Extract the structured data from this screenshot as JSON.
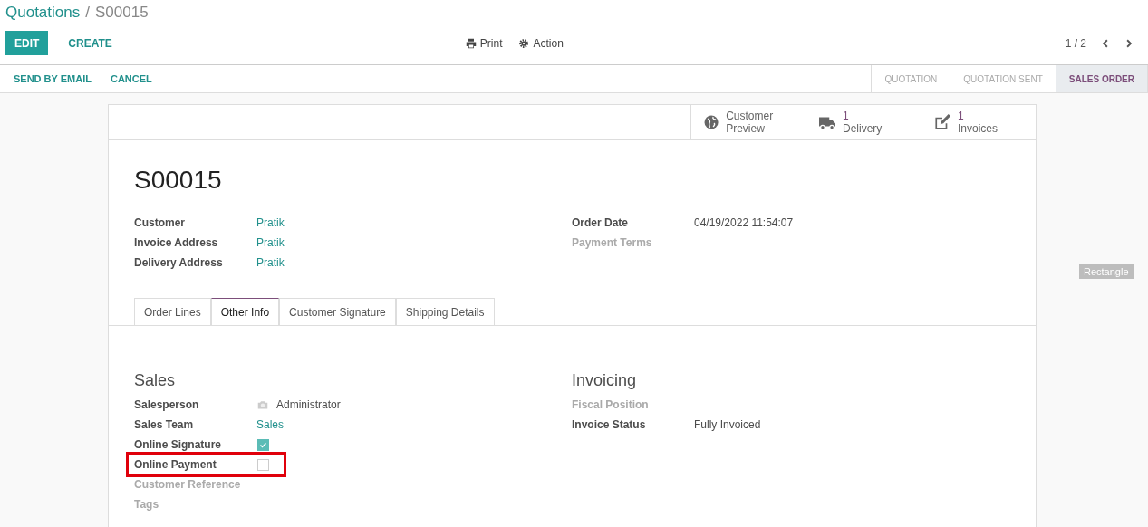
{
  "breadcrumb": {
    "parent": "Quotations",
    "separator": "/",
    "current": "S00015"
  },
  "buttons": [
    {
      "label": "EDIT",
      "primary": true
    },
    {
      "label": "CREATE",
      "primary": false
    }
  ],
  "actions": [
    {
      "label": "Print",
      "kind": "print"
    },
    {
      "label": "Action",
      "kind": "gear"
    }
  ],
  "pager": {
    "text": "1 / 2"
  },
  "header_buttons": [
    "SEND BY EMAIL",
    "CANCEL"
  ],
  "stages": [
    {
      "label": "QUOTATION",
      "selected": false
    },
    {
      "label": "QUOTATION SENT",
      "selected": false
    },
    {
      "label": "SALES ORDER",
      "selected": true
    }
  ],
  "smart_buttons": [
    {
      "kind": "globe",
      "label": "Customer Preview"
    },
    {
      "kind": "truck",
      "count": "1",
      "label": "Delivery"
    },
    {
      "kind": "edit",
      "count": "1",
      "label": "Invoices"
    }
  ],
  "title": "S00015",
  "fields_left": [
    {
      "label": "Customer",
      "value": "Pratik",
      "kind": "link",
      "empty": false
    },
    {
      "label": "Invoice Address",
      "value": "Pratik",
      "kind": "link",
      "empty": false
    },
    {
      "label": "Delivery Address",
      "value": "Pratik",
      "kind": "link",
      "empty": false
    }
  ],
  "fields_right": [
    {
      "label": "Order Date",
      "value": "04/19/2022 11:54:07",
      "kind": "text",
      "empty": false
    },
    {
      "label": "Payment Terms",
      "kind": "text",
      "empty": true
    }
  ],
  "tabs": [
    {
      "label": "Order Lines",
      "selected": false
    },
    {
      "label": "Other Info",
      "selected": true
    },
    {
      "label": "Customer Signature",
      "selected": false
    },
    {
      "label": "Shipping Details",
      "selected": false
    }
  ],
  "groups": [
    {
      "title": "Sales",
      "fields": [
        {
          "label": "Salesperson",
          "value": "Administrator",
          "kind": "avatar",
          "empty": false
        },
        {
          "label": "Sales Team",
          "value": "Sales",
          "kind": "link",
          "empty": false
        },
        {
          "label": "Online Signature",
          "kind": "checkbox",
          "checked": true,
          "empty": false
        },
        {
          "label": "Online Payment",
          "kind": "checkbox",
          "checked": false,
          "empty": false,
          "highlighted": true
        },
        {
          "label": "Customer Reference",
          "kind": "text",
          "empty": true
        },
        {
          "label": "Tags",
          "kind": "text",
          "empty": true
        }
      ]
    },
    {
      "title": "Invoicing",
      "fields": [
        {
          "label": "Fiscal Position",
          "kind": "text",
          "empty": true
        },
        {
          "label": "Invoice Status",
          "value": "Fully Invoiced",
          "kind": "text",
          "empty": false
        }
      ]
    }
  ],
  "overlay_label": "Rectangle"
}
